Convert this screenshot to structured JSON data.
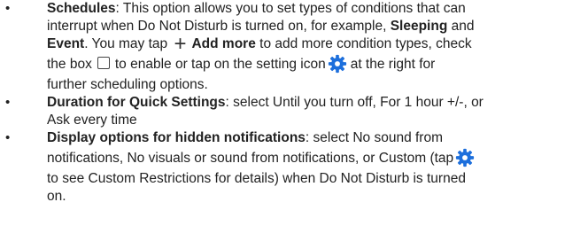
{
  "bullet_symbol": "•",
  "icons": {
    "plus": "plus-icon",
    "checkbox": "checkbox-icon",
    "settings": "gear-icon",
    "settings_color": "#1d6fdc"
  },
  "items": [
    {
      "term": "Schedules",
      "l1_rest": ": This option allows you to set types of conditions that can",
      "l2_a": "interrupt when Do Not Disturb is turned on, for example, ",
      "l2_b": "Sleeping",
      "l2_c": " and",
      "l3_a": "Event",
      "l3_b": ". You may tap ",
      "l3_plus": "+",
      "l3_c": "Add more",
      "l3_d": " to add more condition types, check",
      "l4_a": "the box",
      "l4_b": "to enable or tap on the setting icon",
      "l4_c": "at the right for",
      "l5": "further scheduling options."
    },
    {
      "term": "Duration for Quick Settings",
      "l1_rest": ": select Until you turn off, For 1 hour +/-, or",
      "l2": "Ask every time"
    },
    {
      "term": "Display options for hidden notifications",
      "l1_rest": ": select No sound from",
      "l2_a": "notifications, No visuals or sound from notifications, or Custom (tap",
      "l3": "to see Custom Restrictions for details) when Do Not Disturb is turned",
      "l4": "on."
    }
  ]
}
